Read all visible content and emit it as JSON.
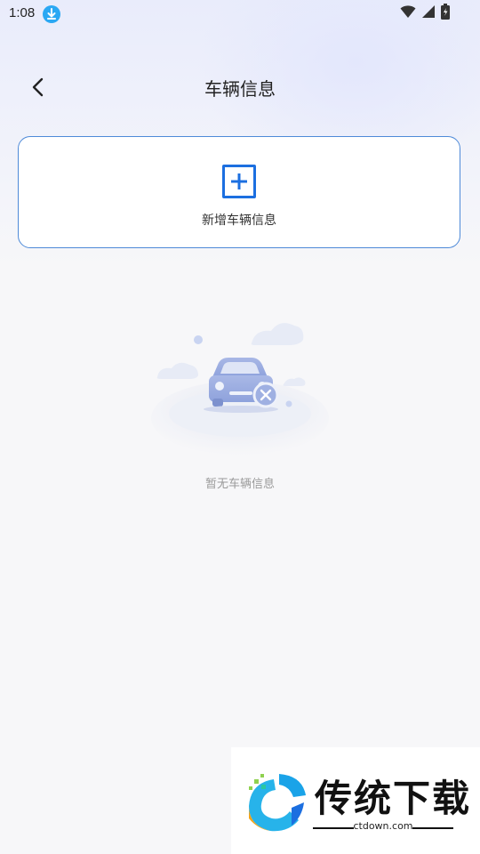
{
  "status_bar": {
    "time": "1:08",
    "icons": [
      "download-icon",
      "wifi-icon",
      "signal-icon",
      "battery-charging-icon"
    ]
  },
  "header": {
    "title": "车辆信息",
    "back_icon": "chevron-left-icon"
  },
  "add_card": {
    "icon": "add-square-icon",
    "label": "新增车辆信息",
    "accent": "#1c6fe0",
    "border": "#4e8ad8"
  },
  "empty_state": {
    "illustration": "car-empty-icon",
    "text": "暂无车辆信息"
  },
  "watermark": {
    "brand": "传统下载",
    "url": "ctdown.com"
  }
}
